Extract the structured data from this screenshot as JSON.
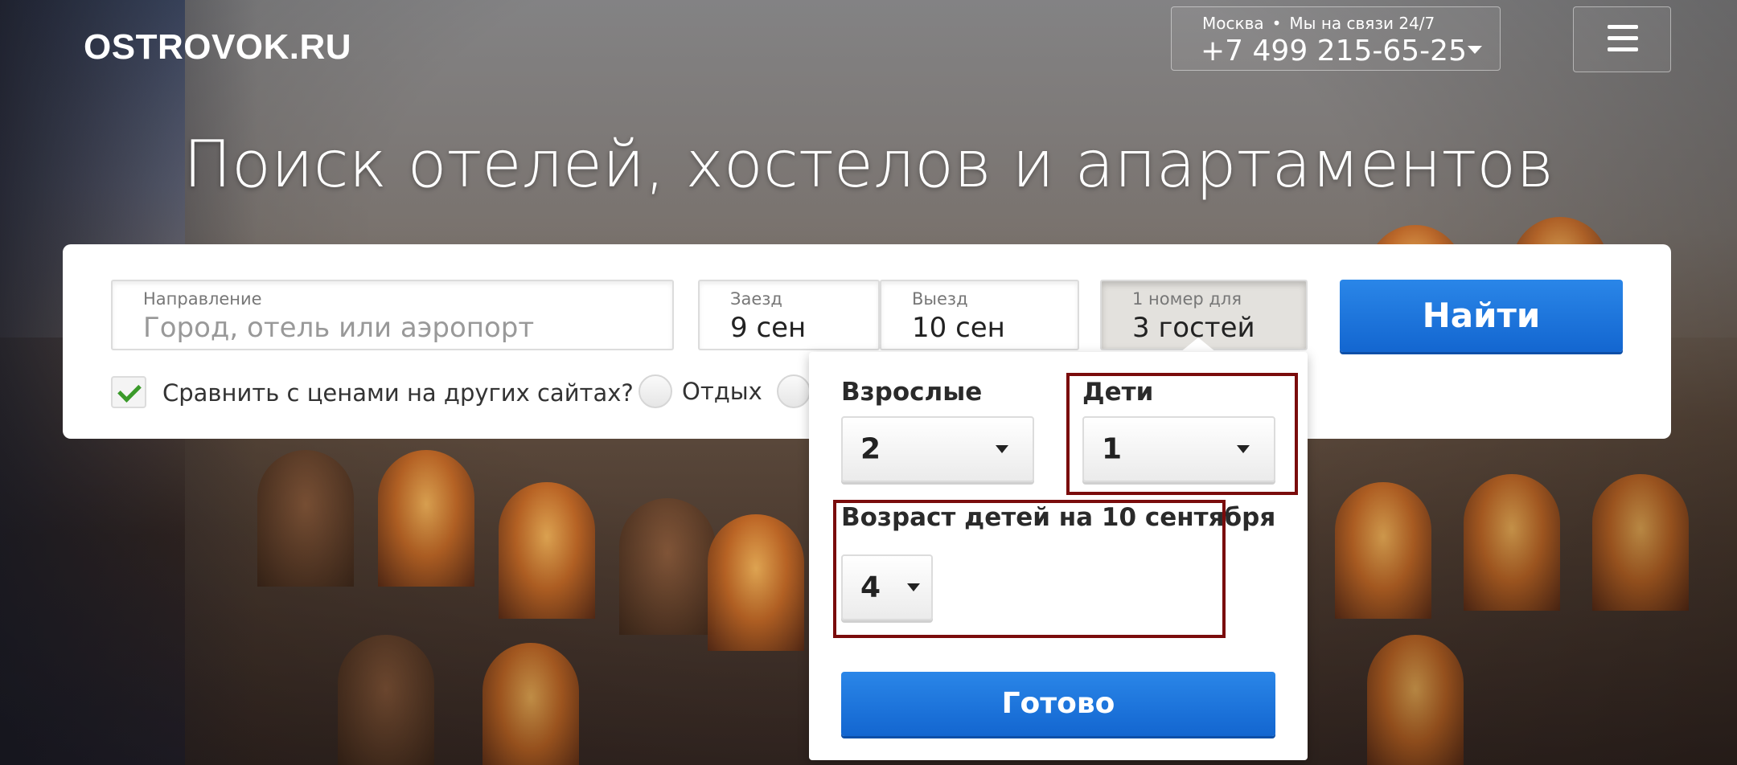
{
  "header": {
    "logo": "OSTROVOK.RU",
    "city": "Москва",
    "separator": "•",
    "support": "Мы на связи 24/7",
    "phone": "+7 499 215-65-25"
  },
  "hero": {
    "title": "Поиск отелей, хостелов и апартаментов"
  },
  "search": {
    "destination_label": "Направление",
    "destination_placeholder": "Город, отель или аэропорт",
    "checkin_label": "Заезд",
    "checkin_value": "9 сен",
    "checkout_label": "Выезд",
    "checkout_value": "10 сен",
    "guests_label": "1 номер для",
    "guests_value": "3 гостей",
    "find_button": "Найти",
    "compare_label": "Сравнить с ценами на других сайтах?",
    "compare_checked": true,
    "trip_option_1": "Отдых"
  },
  "guests_popup": {
    "adults_label": "Взрослые",
    "adults_value": "2",
    "children_label": "Дети",
    "children_value": "1",
    "children_age_label": "Возраст детей на 10 сентября",
    "child_age_value": "4",
    "done_button": "Готово"
  },
  "colors": {
    "primary_button": "#1a73dc",
    "highlight_border": "#7a0c0c",
    "check_mark": "#3a9a2a"
  }
}
